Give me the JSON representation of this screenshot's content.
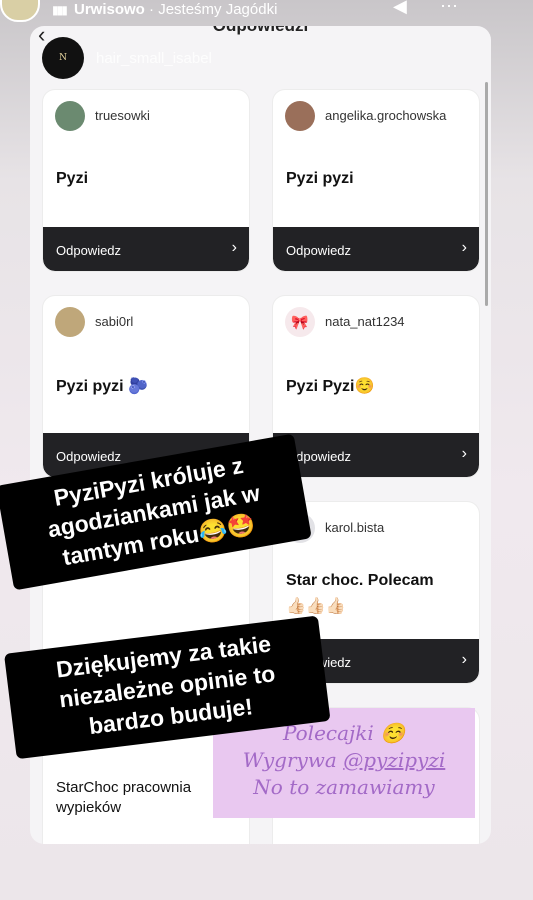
{
  "story": {
    "song": "Urwisowo",
    "separator": " · ",
    "artist": "Jesteśmy Jagódki"
  },
  "panel": {
    "title": "Odpowiedzi",
    "profile_name": "hair_small_isabel",
    "profile_avatar_text": "N"
  },
  "cards": [
    {
      "user": "truesowki",
      "answer": "Pyzi",
      "reply": "Odpowiedz",
      "avatar_color": "#6b8a70"
    },
    {
      "user": "angelika.grochowska",
      "answer": "Pyzi pyzi",
      "reply": "Odpowiedz",
      "avatar_color": "#9a6f5a"
    },
    {
      "user": "sabi0rl",
      "answer": "Pyzi pyzi 🫐",
      "reply": "Odpowiedz",
      "avatar_color": "#bfa77a"
    },
    {
      "user": "nata_nat1234",
      "answer": "Pyzi Pyzi☺️",
      "reply": "Odpowiedz",
      "avatar_color": "#f6e9ec"
    },
    {
      "user": "karol.bista",
      "answer": "Star choc. Polecam",
      "extra": "👍🏻👍🏻👍🏻",
      "reply": "Odpowiedz",
      "avatar_color": "#e2e2e6"
    },
    {
      "answer": "StarChoc pracownia wypieków"
    }
  ],
  "stickers": {
    "first": [
      "PyziPyzi króluje z",
      "agodziankami jak w",
      "tamtym roku😂🤩"
    ],
    "second": [
      "Dziękujemy za takie",
      "niezależne opinie to",
      "bardzo buduje!"
    ]
  },
  "polecajki": {
    "line1": "Polecajki ☺️",
    "line2_prefix": "Wygrywa ",
    "line2_tag": "@pyzipyzi",
    "line3": "No to zamawiamy"
  }
}
